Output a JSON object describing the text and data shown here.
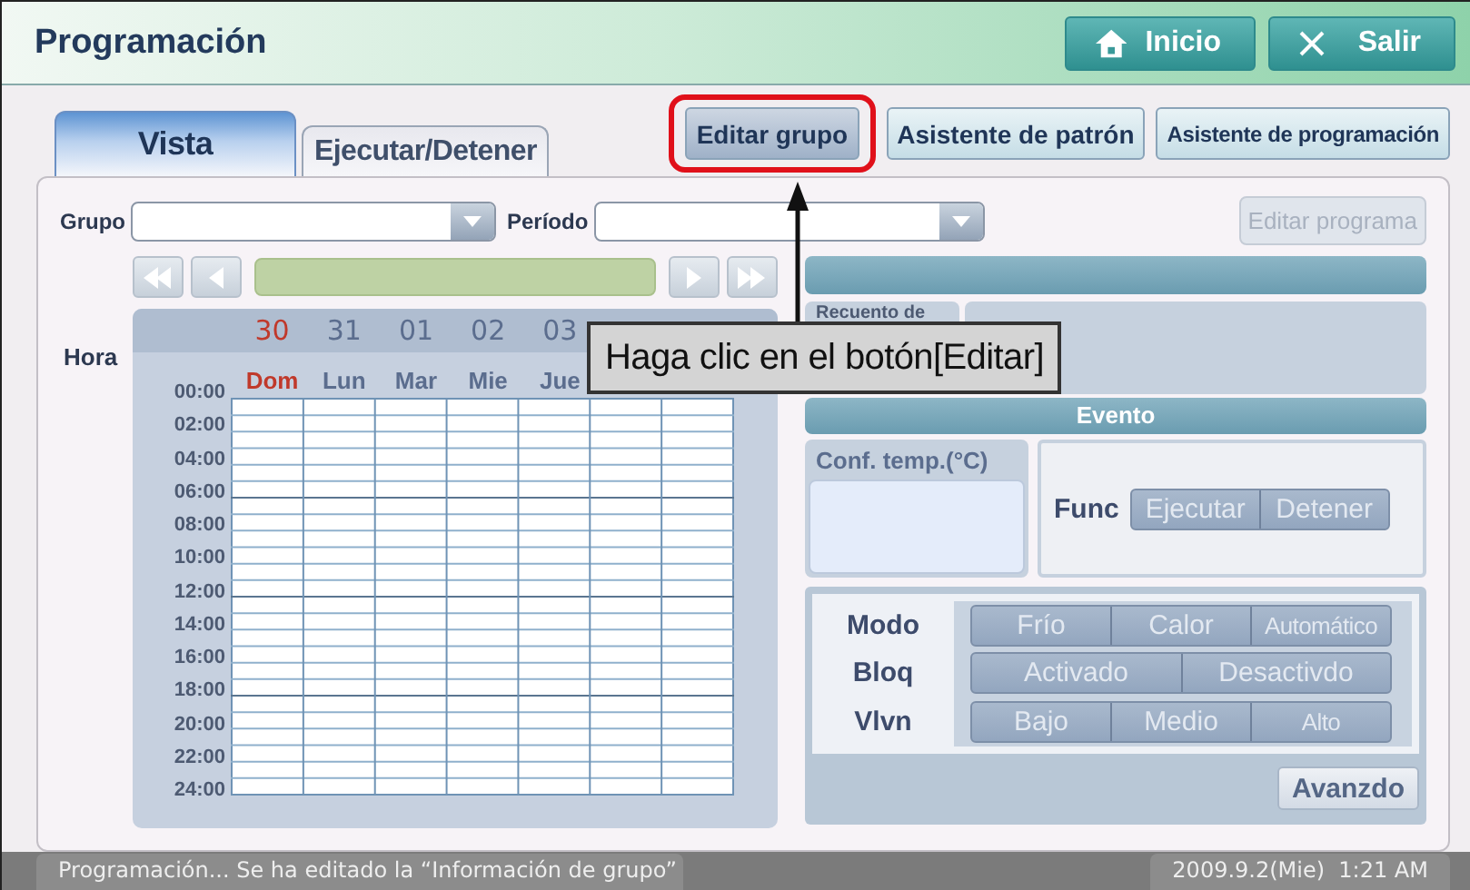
{
  "window": {
    "title": "Programación"
  },
  "header_buttons": [
    {
      "label": "Inicio",
      "kind": "home"
    },
    {
      "label": "Salir",
      "kind": "exit"
    }
  ],
  "tabs": [
    {
      "label": "Vista",
      "selected": true
    },
    {
      "label": "Ejecutar/Detener",
      "selected": false
    }
  ],
  "toolbar_buttons": [
    {
      "label": "Editar grupo",
      "highlighted": true
    },
    {
      "label": "Asistente de patrón",
      "highlighted": false
    },
    {
      "label": "Asistente de programación",
      "highlighted": false
    }
  ],
  "filters": [
    {
      "label": "Grupo"
    },
    {
      "label": "Período"
    }
  ],
  "edit_program_button": {
    "label": "Editar programa",
    "disabled": true
  },
  "calendar": {
    "hour_label": "Hora",
    "dates": [
      {
        "date": "30",
        "day": "Dom",
        "holiday": true
      },
      {
        "date": "31",
        "day": "Lun",
        "holiday": false
      },
      {
        "date": "01",
        "day": "Mar",
        "holiday": false
      },
      {
        "date": "02",
        "day": "Mie",
        "holiday": false
      },
      {
        "date": "03",
        "day": "Jue",
        "holiday": false
      }
    ],
    "hours": [
      "00:00",
      "02:00",
      "04:00",
      "06:00",
      "08:00",
      "10:00",
      "12:00",
      "14:00",
      "16:00",
      "18:00",
      "20:00",
      "22:00",
      "24:00"
    ]
  },
  "event_panel": {
    "recount_label": "Recuento de",
    "event_title": "Evento",
    "temp_label": "Conf. temp.(°C)",
    "func_label": "Func",
    "func_options": [
      "Ejecutar",
      "Detener"
    ],
    "settings": [
      {
        "label": "Modo",
        "options": [
          "Frío",
          "Calor",
          "Automático"
        ]
      },
      {
        "label": "Bloq",
        "options": [
          "Activado",
          "Desactivdo"
        ]
      },
      {
        "label": "Vlvn",
        "options": [
          "Bajo",
          "Medio",
          "Alto"
        ]
      }
    ],
    "advanced_button": "Avanzdo"
  },
  "callout": {
    "text": "Haga clic en el botón[Editar]"
  },
  "status_bar": {
    "message": "Programación... Se ha editado la “Información de grupo”",
    "datetime": "2009.9.2(Mie)  1:21 AM"
  }
}
